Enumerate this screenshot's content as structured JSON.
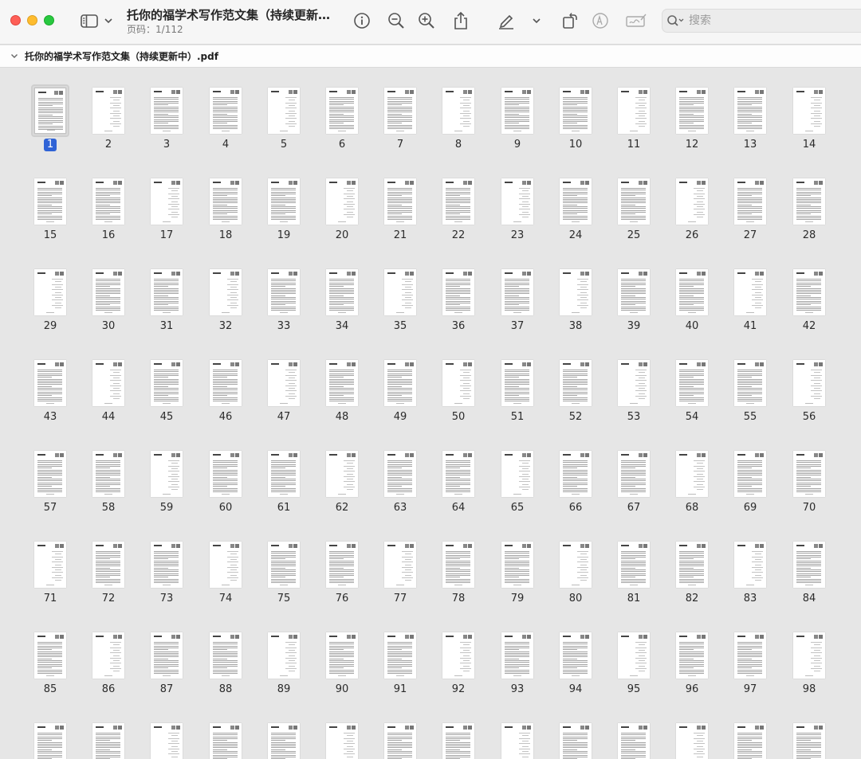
{
  "window": {
    "title": "托你的福学术写作范文集（持续更新中...",
    "page_label": "页码：",
    "page_value": "1/112"
  },
  "search": {
    "placeholder": "搜索"
  },
  "file": {
    "name": "托你的福学术写作范文集（持续更新中）.pdf"
  },
  "thumbnails": {
    "selected_page": 1,
    "pages": [
      "1",
      "2",
      "3",
      "4",
      "5",
      "6",
      "7",
      "8",
      "9",
      "10",
      "11",
      "12",
      "13",
      "14",
      "15",
      "16",
      "17",
      "18",
      "19",
      "20",
      "21",
      "22",
      "23",
      "24",
      "25",
      "26",
      "27",
      "28",
      "29",
      "30",
      "31",
      "32",
      "33",
      "34",
      "35",
      "36",
      "37",
      "38",
      "39",
      "40",
      "41",
      "42",
      "43",
      "44",
      "45",
      "46",
      "47",
      "48",
      "49",
      "50",
      "51",
      "52",
      "53",
      "54",
      "55",
      "56",
      "57",
      "58",
      "59",
      "60",
      "61",
      "62",
      "63",
      "64",
      "65",
      "66",
      "67",
      "68",
      "69",
      "70",
      "71",
      "72",
      "73",
      "74",
      "75",
      "76",
      "77",
      "78",
      "79",
      "80",
      "81",
      "82",
      "83",
      "84",
      "85",
      "86",
      "87",
      "88",
      "89",
      "90",
      "91",
      "92",
      "93",
      "94",
      "95",
      "96",
      "97",
      "98"
    ],
    "partial_row_count": 14
  },
  "colors": {
    "selection": "#2f63d6",
    "close": "#fe5f57",
    "minimize": "#febc2e",
    "zoom": "#28c840"
  },
  "icons": [
    "sidebar-icon",
    "chevron-down-icon",
    "info-icon",
    "zoom-out-icon",
    "zoom-in-icon",
    "share-icon",
    "markup-pen-icon",
    "rotate-icon",
    "markup-circle-icon",
    "signature-icon",
    "search-icon"
  ]
}
